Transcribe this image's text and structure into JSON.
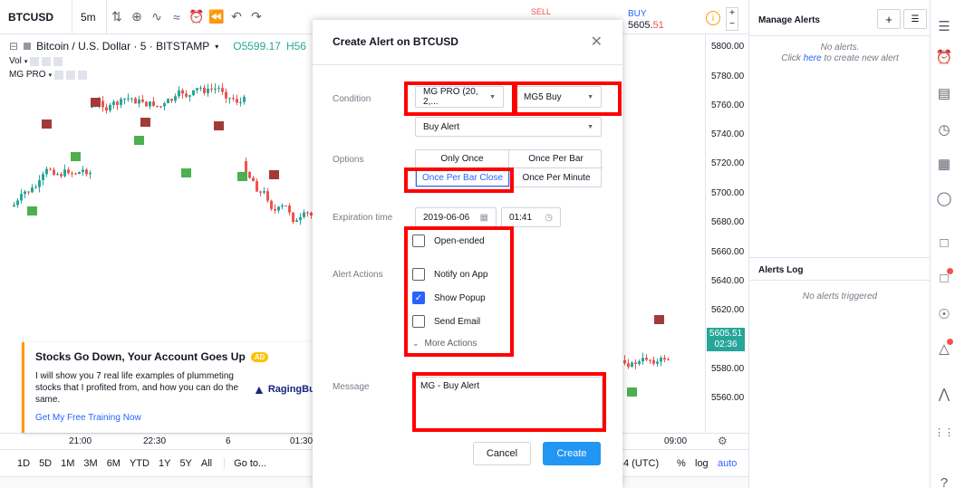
{
  "toolbar": {
    "symbol": "BTCUSD",
    "interval": "5m",
    "icons": [
      "bar-style-icon",
      "add-compare-icon",
      "indicators-icon",
      "templates-icon",
      "alert-icon",
      "replay-icon",
      "undo-icon",
      "redo-icon"
    ]
  },
  "chart": {
    "legend_title": "Bitcoin / U.S. Dollar · 5 · BITSTAMP",
    "legend_open": "O5599.17",
    "legend_high": "H56",
    "vol_label": "Vol",
    "indicator_label": "MG PRO",
    "sell_label": "SELL",
    "buy_label": "BUY",
    "buy_price_prefix": "5605.",
    "buy_price_suffix": "51",
    "current_price": "5605.51",
    "current_time": "02:36",
    "colors": {
      "up": "#26a69a",
      "down": "#ef5350",
      "accent": "#2962ff"
    }
  },
  "price_axis": [
    "5800.00",
    "5780.00",
    "5760.00",
    "5740.00",
    "5720.00",
    "5700.00",
    "5680.00",
    "5660.00",
    "5640.00",
    "5620.00",
    "5580.00",
    "5560.00"
  ],
  "time_axis": [
    "21:00",
    "22:30",
    "6",
    "01:30",
    "09:00"
  ],
  "bottom_bar": {
    "ranges": [
      "1D",
      "5D",
      "1M",
      "3M",
      "6M",
      "YTD",
      "1Y",
      "5Y",
      "All"
    ],
    "goto": "Go to...",
    "timezone": "4 (UTC)",
    "percent": "%",
    "log": "log",
    "auto": "auto"
  },
  "ad": {
    "title": "Stocks Go Down, Your Account Goes Up",
    "badge": "AD",
    "text": "I will show you 7 real life examples of plummeting stocks that I profited from, and how you can do the same.",
    "link": "Get My Free Training Now",
    "brand": "RagingBu"
  },
  "dialog": {
    "title": "Create Alert on BTCUSD",
    "condition_label": "Condition",
    "condition_source": "MG PRO (20, 2,...",
    "condition_signal": "MG5 Buy",
    "condition_alert": "Buy Alert",
    "options_label": "Options",
    "options": [
      "Only Once",
      "Once Per Bar",
      "Once Per Bar Close",
      "Once Per Minute"
    ],
    "selected_option": "Once Per Bar Close",
    "expiration_label": "Expiration time",
    "expiration_date": "2019-06-06",
    "expiration_time": "01:41",
    "open_ended": "Open-ended",
    "actions_label": "Alert Actions",
    "actions": [
      {
        "label": "Notify on App",
        "checked": false
      },
      {
        "label": "Show Popup",
        "checked": true
      },
      {
        "label": "Send Email",
        "checked": false
      }
    ],
    "more_actions": "More Actions",
    "message_label": "Message",
    "message_value": "MG - Buy Alert",
    "cancel": "Cancel",
    "create": "Create"
  },
  "alerts_panel": {
    "title": "Manage Alerts",
    "empty_line1": "No alerts.",
    "empty_click": "Click ",
    "empty_here": "here",
    "empty_rest": " to create new alert",
    "log_title": "Alerts Log",
    "log_empty": "No alerts triggered"
  },
  "iconbar": [
    "watchlist-icon",
    "alarm-clock-icon",
    "data-window-icon",
    "hotlist-icon",
    "calendar-icon",
    "ideas-icon",
    "chat-icon",
    "private-chat-icon",
    "streams-icon",
    "notifications-icon",
    "chart-icon",
    "apps-icon",
    "help-icon"
  ]
}
